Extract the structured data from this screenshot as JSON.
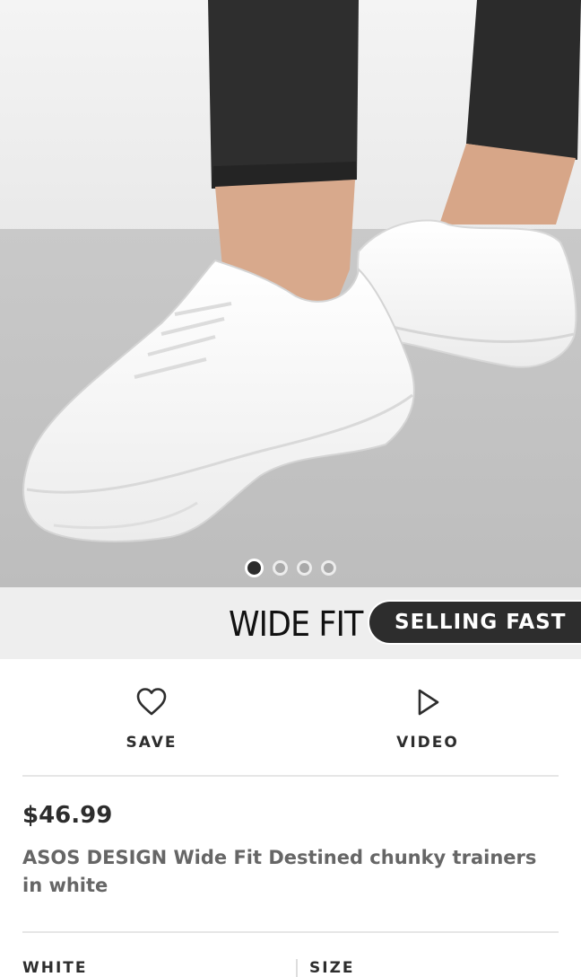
{
  "hero": {
    "image_alt": "White chunky trainers on feet",
    "carousel": {
      "total": 4,
      "active_index": 0
    }
  },
  "badges": {
    "wide_fit": "WIDE FIT",
    "selling_fast": "SELLING FAST"
  },
  "actions": {
    "save_label": "SAVE",
    "save_icon": "heart-icon",
    "video_label": "VIDEO",
    "video_icon": "play-icon"
  },
  "product": {
    "price": "$46.99",
    "title": "ASOS DESIGN Wide Fit Destined chunky trainers in white"
  },
  "options": {
    "colour_label": "WHITE",
    "size_label": "SIZE"
  },
  "colors": {
    "text_dark": "#2d2d2d",
    "text_muted": "#666666",
    "badge_bg": "#2d2d2d",
    "divider": "#e6e6e6"
  }
}
